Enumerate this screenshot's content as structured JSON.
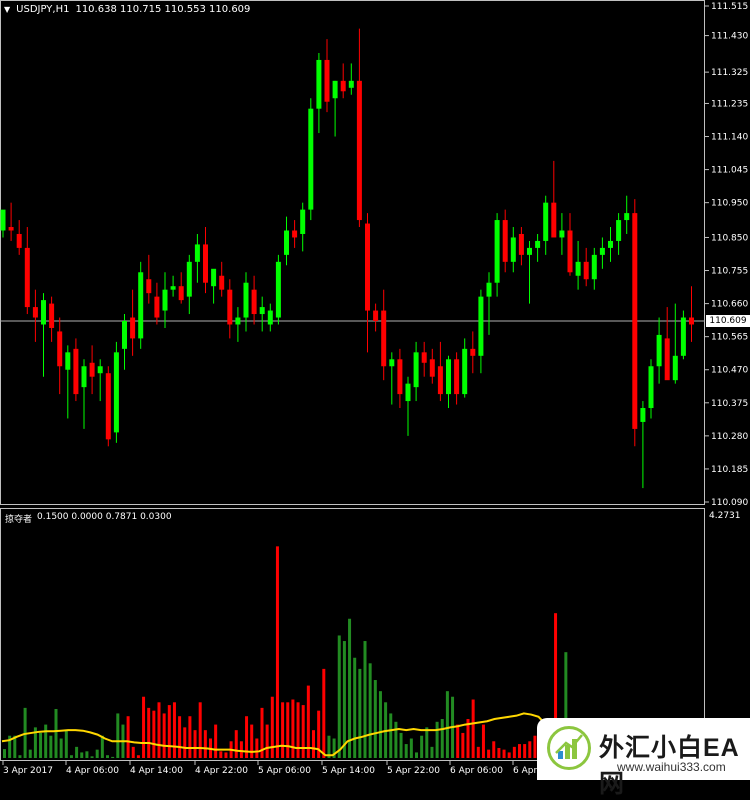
{
  "chart_header": {
    "symbol_timeframe": "USDJPY,H1",
    "ohlc": "110.638 110.715 110.553 110.609"
  },
  "indicator_header": {
    "name": "掠夺者",
    "values": "0.1500 0.0000 0.7871 0.0300"
  },
  "price_axis": {
    "labels": [
      "111.515",
      "111.430",
      "111.325",
      "111.235",
      "111.140",
      "111.045",
      "110.950",
      "110.850",
      "110.755",
      "110.660",
      "110.565",
      "110.470",
      "110.375",
      "110.280",
      "110.185",
      "110.090"
    ],
    "current_price": "110.609"
  },
  "indicator_axis": {
    "max_label": "4.2731"
  },
  "time_axis": {
    "labels": [
      "3 Apr 2017",
      "4 Apr 06:00",
      "4 Apr 14:00",
      "4 Apr 22:00",
      "5 Apr 06:00",
      "5 Apr 14:00",
      "5 Apr 22:00",
      "6 Apr 06:00",
      "6 Apr"
    ]
  },
  "watermark": {
    "brand": "外汇小白EA网",
    "url": "www.waihui333.com"
  },
  "colors": {
    "background": "#000000",
    "bull": "#00FF00",
    "bear": "#FF0000",
    "hist_green": "#228B22",
    "hist_red": "#FF0000",
    "ma_line": "#FFD700",
    "axis_text": "#FFFFFF"
  },
  "chart_data": [
    {
      "type": "candlestick",
      "symbol": "USDJPY",
      "timeframe": "H1",
      "ylim": [
        110.09,
        111.515
      ],
      "candles": [
        [
          110.87,
          110.92,
          110.85,
          110.93
        ],
        [
          110.88,
          110.95,
          110.84,
          110.87
        ],
        [
          110.86,
          110.9,
          110.8,
          110.82
        ],
        [
          110.82,
          110.88,
          110.63,
          110.65
        ],
        [
          110.65,
          110.7,
          110.55,
          110.62
        ],
        [
          110.6,
          110.69,
          110.45,
          110.67
        ],
        [
          110.66,
          110.68,
          110.55,
          110.59
        ],
        [
          110.58,
          110.62,
          110.4,
          110.48
        ],
        [
          110.47,
          110.54,
          110.33,
          110.52
        ],
        [
          110.53,
          110.56,
          110.38,
          110.4
        ],
        [
          110.42,
          110.5,
          110.3,
          110.48
        ],
        [
          110.49,
          110.54,
          110.4,
          110.45
        ],
        [
          110.46,
          110.5,
          110.38,
          110.48
        ],
        [
          110.46,
          110.48,
          110.25,
          110.27
        ],
        [
          110.29,
          110.55,
          110.26,
          110.52
        ],
        [
          110.53,
          110.63,
          110.47,
          110.61
        ],
        [
          110.62,
          110.7,
          110.51,
          110.56
        ],
        [
          110.56,
          110.78,
          110.53,
          110.75
        ],
        [
          110.73,
          110.8,
          110.66,
          110.69
        ],
        [
          110.68,
          110.72,
          110.6,
          110.62
        ],
        [
          110.64,
          110.75,
          110.59,
          110.7
        ],
        [
          110.7,
          110.74,
          110.68,
          110.71
        ],
        [
          110.71,
          110.75,
          110.66,
          110.67
        ],
        [
          110.68,
          110.8,
          110.63,
          110.78
        ],
        [
          110.78,
          110.86,
          110.72,
          110.83
        ],
        [
          110.83,
          110.88,
          110.69,
          110.72
        ],
        [
          110.71,
          110.75,
          110.66,
          110.76
        ],
        [
          110.74,
          110.78,
          110.68,
          110.7
        ],
        [
          110.7,
          110.73,
          110.56,
          110.6
        ],
        [
          110.6,
          110.65,
          110.55,
          110.62
        ],
        [
          110.62,
          110.75,
          110.58,
          110.72
        ],
        [
          110.7,
          110.74,
          110.6,
          110.63
        ],
        [
          110.63,
          110.68,
          110.58,
          110.65
        ],
        [
          110.6,
          110.66,
          110.58,
          110.64
        ],
        [
          110.62,
          110.8,
          110.6,
          110.78
        ],
        [
          110.8,
          110.91,
          110.77,
          110.87
        ],
        [
          110.87,
          110.9,
          110.82,
          110.85
        ],
        [
          110.86,
          110.95,
          110.81,
          110.93
        ],
        [
          110.93,
          111.25,
          110.9,
          111.22
        ],
        [
          111.22,
          111.38,
          111.15,
          111.36
        ],
        [
          111.36,
          111.42,
          111.21,
          111.24
        ],
        [
          111.25,
          111.3,
          111.14,
          111.3
        ],
        [
          111.3,
          111.35,
          111.25,
          111.27
        ],
        [
          111.28,
          111.35,
          111.26,
          111.3
        ],
        [
          111.3,
          111.45,
          110.88,
          110.9
        ],
        [
          110.89,
          110.92,
          110.52,
          110.64
        ],
        [
          110.64,
          110.66,
          110.58,
          110.61
        ],
        [
          110.64,
          110.7,
          110.44,
          110.48
        ],
        [
          110.48,
          110.52,
          110.37,
          110.5
        ],
        [
          110.5,
          110.53,
          110.36,
          110.4
        ],
        [
          110.38,
          110.45,
          110.28,
          110.43
        ],
        [
          110.42,
          110.55,
          110.38,
          110.52
        ],
        [
          110.52,
          110.55,
          110.45,
          110.49
        ],
        [
          110.5,
          110.53,
          110.43,
          110.45
        ],
        [
          110.48,
          110.55,
          110.38,
          110.4
        ],
        [
          110.4,
          110.51,
          110.36,
          110.5
        ],
        [
          110.5,
          110.52,
          110.37,
          110.4
        ],
        [
          110.4,
          110.56,
          110.39,
          110.53
        ],
        [
          110.53,
          110.58,
          110.46,
          110.51
        ],
        [
          110.51,
          110.7,
          110.46,
          110.68
        ],
        [
          110.68,
          110.75,
          110.57,
          110.72
        ],
        [
          110.72,
          110.92,
          110.68,
          110.9
        ],
        [
          110.9,
          110.93,
          110.75,
          110.78
        ],
        [
          110.78,
          110.88,
          110.75,
          110.85
        ],
        [
          110.86,
          110.88,
          110.77,
          110.8
        ],
        [
          110.8,
          110.84,
          110.66,
          110.82
        ],
        [
          110.82,
          110.86,
          110.78,
          110.84
        ],
        [
          110.84,
          110.97,
          110.8,
          110.95
        ],
        [
          110.95,
          111.07,
          110.88,
          110.85
        ],
        [
          110.85,
          110.92,
          110.8,
          110.87
        ],
        [
          110.87,
          110.92,
          110.74,
          110.75
        ],
        [
          110.74,
          110.84,
          110.7,
          110.78
        ],
        [
          110.78,
          110.82,
          110.71,
          110.73
        ],
        [
          110.73,
          110.82,
          110.7,
          110.8
        ],
        [
          110.8,
          110.85,
          110.76,
          110.82
        ],
        [
          110.82,
          110.88,
          110.78,
          110.84
        ],
        [
          110.84,
          110.92,
          110.8,
          110.9
        ],
        [
          110.9,
          110.97,
          110.86,
          110.92
        ],
        [
          110.92,
          110.96,
          110.25,
          110.3
        ],
        [
          110.32,
          110.38,
          110.13,
          110.36
        ],
        [
          110.36,
          110.5,
          110.33,
          110.48
        ],
        [
          110.48,
          110.62,
          110.43,
          110.57
        ],
        [
          110.56,
          110.65,
          110.49,
          110.44
        ],
        [
          110.44,
          110.66,
          110.43,
          110.51
        ],
        [
          110.51,
          110.64,
          110.5,
          110.62
        ],
        [
          110.62,
          110.71,
          110.55,
          110.6
        ]
      ]
    },
    {
      "type": "bar",
      "name": "掠夺者",
      "ylim": [
        0,
        4.2731
      ],
      "values": [
        0.16,
        0.4,
        0.4,
        0.05,
        0.9,
        0.15,
        0.55,
        0.45,
        0.6,
        0.4,
        0.88,
        0.35,
        0.5,
        0.05,
        0.2,
        0.1,
        0.12,
        0.03,
        0.15,
        0.4,
        0.05,
        0.02,
        0.8,
        0.6,
        0.75,
        0.2,
        0.05,
        1.1,
        0.9,
        0.85,
        1.0,
        0.8,
        0.95,
        1.0,
        0.75,
        0.55,
        0.75,
        0.5,
        1.0,
        0.5,
        0.35,
        0.6,
        0.12,
        0.1,
        0.3,
        0.5,
        0.3,
        0.75,
        0.6,
        0.35,
        0.9,
        0.6,
        1.1,
        3.8,
        1.0,
        1.0,
        1.05,
        1.0,
        0.95,
        1.3,
        0.5,
        0.85,
        1.6,
        0.4,
        0.35,
        2.2,
        2.1,
        2.5,
        1.8,
        1.6,
        2.1,
        1.7,
        1.4,
        1.2,
        1.0,
        0.8,
        0.65,
        0.45,
        0.25,
        0.35,
        0.1,
        0.4,
        0.55,
        0.2,
        0.65,
        0.7,
        1.2,
        1.1,
        0.6,
        0.45,
        0.7,
        1.05,
        0.2,
        0.6,
        0.15,
        0.3,
        0.18,
        0.15,
        0.1,
        0.2,
        0.25,
        0.25,
        0.3,
        0.4,
        0.2,
        0.18,
        0.28,
        2.6,
        0.6,
        1.9,
        0.3,
        0.5,
        0.35,
        0.45,
        0.3,
        0.2,
        0.45,
        0.25,
        0.18,
        0.15,
        0.1,
        0.05,
        0.1,
        0.08,
        0.12,
        0.15,
        0.2,
        0.05,
        0.05,
        0.05,
        0.05,
        0.05,
        0.05,
        0.05
      ],
      "colors_by_bar": "ggggggggggggggggggggggggrrrrrrrrrrrrrrrrrrrrrrrrrrrrrrrrrrrrrrrgggggggggggggggggggggggggrrrrrrrrrrrrrrrrrrrrrgggggggggggggggggggggggggggggggggggg",
      "ma": [
        0.3,
        0.32,
        0.38,
        0.43,
        0.45,
        0.47,
        0.48,
        0.48,
        0.49,
        0.5,
        0.5,
        0.49,
        0.46,
        0.42,
        0.35,
        0.3,
        0.3,
        0.3,
        0.28,
        0.27,
        0.27,
        0.24,
        0.22,
        0.21,
        0.2,
        0.18,
        0.18,
        0.18,
        0.17,
        0.15,
        0.15,
        0.15,
        0.13,
        0.12,
        0.11,
        0.12,
        0.18,
        0.2,
        0.22,
        0.21,
        0.18,
        0.18,
        0.18,
        0.16,
        0.05,
        0.05,
        0.15,
        0.3,
        0.35,
        0.38,
        0.42,
        0.45,
        0.48,
        0.5,
        0.52,
        0.5,
        0.52,
        0.5,
        0.5,
        0.5,
        0.52,
        0.55,
        0.57,
        0.6,
        0.62,
        0.64,
        0.66,
        0.7,
        0.72,
        0.74,
        0.76,
        0.8,
        0.78,
        0.74,
        0.6,
        0.45,
        0.3,
        0.25,
        0.25,
        0.24,
        0.22,
        0.2,
        0.18,
        0.17,
        0.18,
        0.2,
        0.22,
        0.22,
        0.24,
        0.25,
        0.26,
        0.26,
        0.25,
        0.24,
        0.24
      ]
    }
  ]
}
